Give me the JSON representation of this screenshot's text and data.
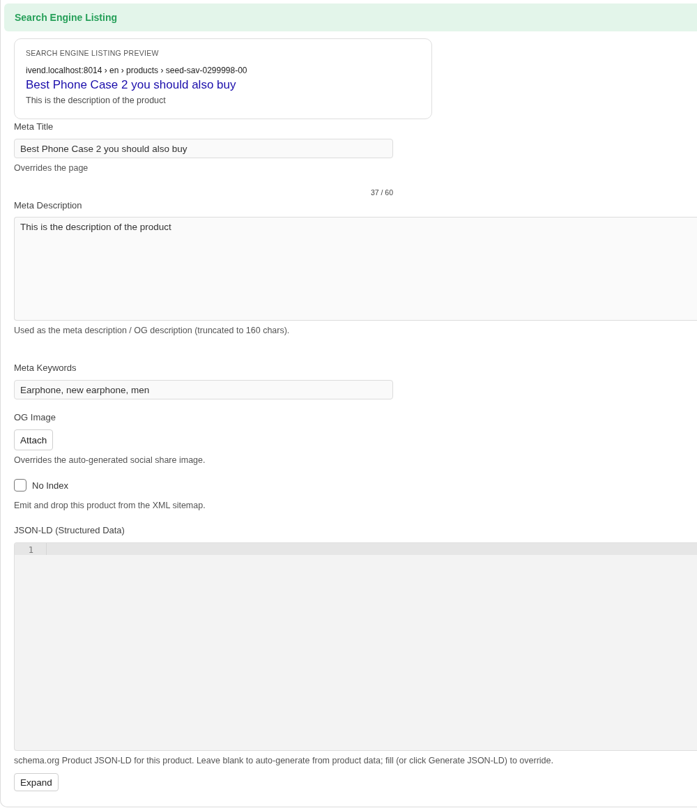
{
  "section": {
    "title": "Search Engine Listing"
  },
  "preview": {
    "heading": "SEARCH ENGINE LISTING PREVIEW",
    "breadcrumb": "ivend.localhost:8014 › en › products › seed-sav-0299998-00",
    "title": "Best Phone Case 2 you should also buy",
    "description": "This is the description of the product"
  },
  "fields": [
    {
      "kind": "input",
      "label": "Meta Title",
      "value": "Best Phone Case 2 you should also buy",
      "help": "Overrides the page",
      "counter": "37 / 60"
    },
    {
      "kind": "textarea",
      "label": "Meta Description",
      "value": "This is the description of the product",
      "help": "Used as the meta description / OG description (truncated to 160 chars)."
    },
    {
      "kind": "input",
      "label": "Meta Keywords",
      "value": "Earphone, new earphone, men"
    },
    {
      "kind": "attach",
      "label": "OG Image",
      "button": "Attach",
      "help": "Overrides the auto-generated social share image."
    },
    {
      "kind": "checkbox",
      "label": "No Index",
      "checked": false,
      "help": "Emit and drop this product from the XML sitemap."
    },
    {
      "kind": "code",
      "label": "JSON-LD (Structured Data)",
      "lines": [
        {
          "number": "1",
          "active": true
        }
      ],
      "help": "schema.org Product JSON-LD for this product. Leave blank to auto-generate from product data; fill (or click Generate JSON-LD) to override.",
      "button": "Expand"
    }
  ]
}
